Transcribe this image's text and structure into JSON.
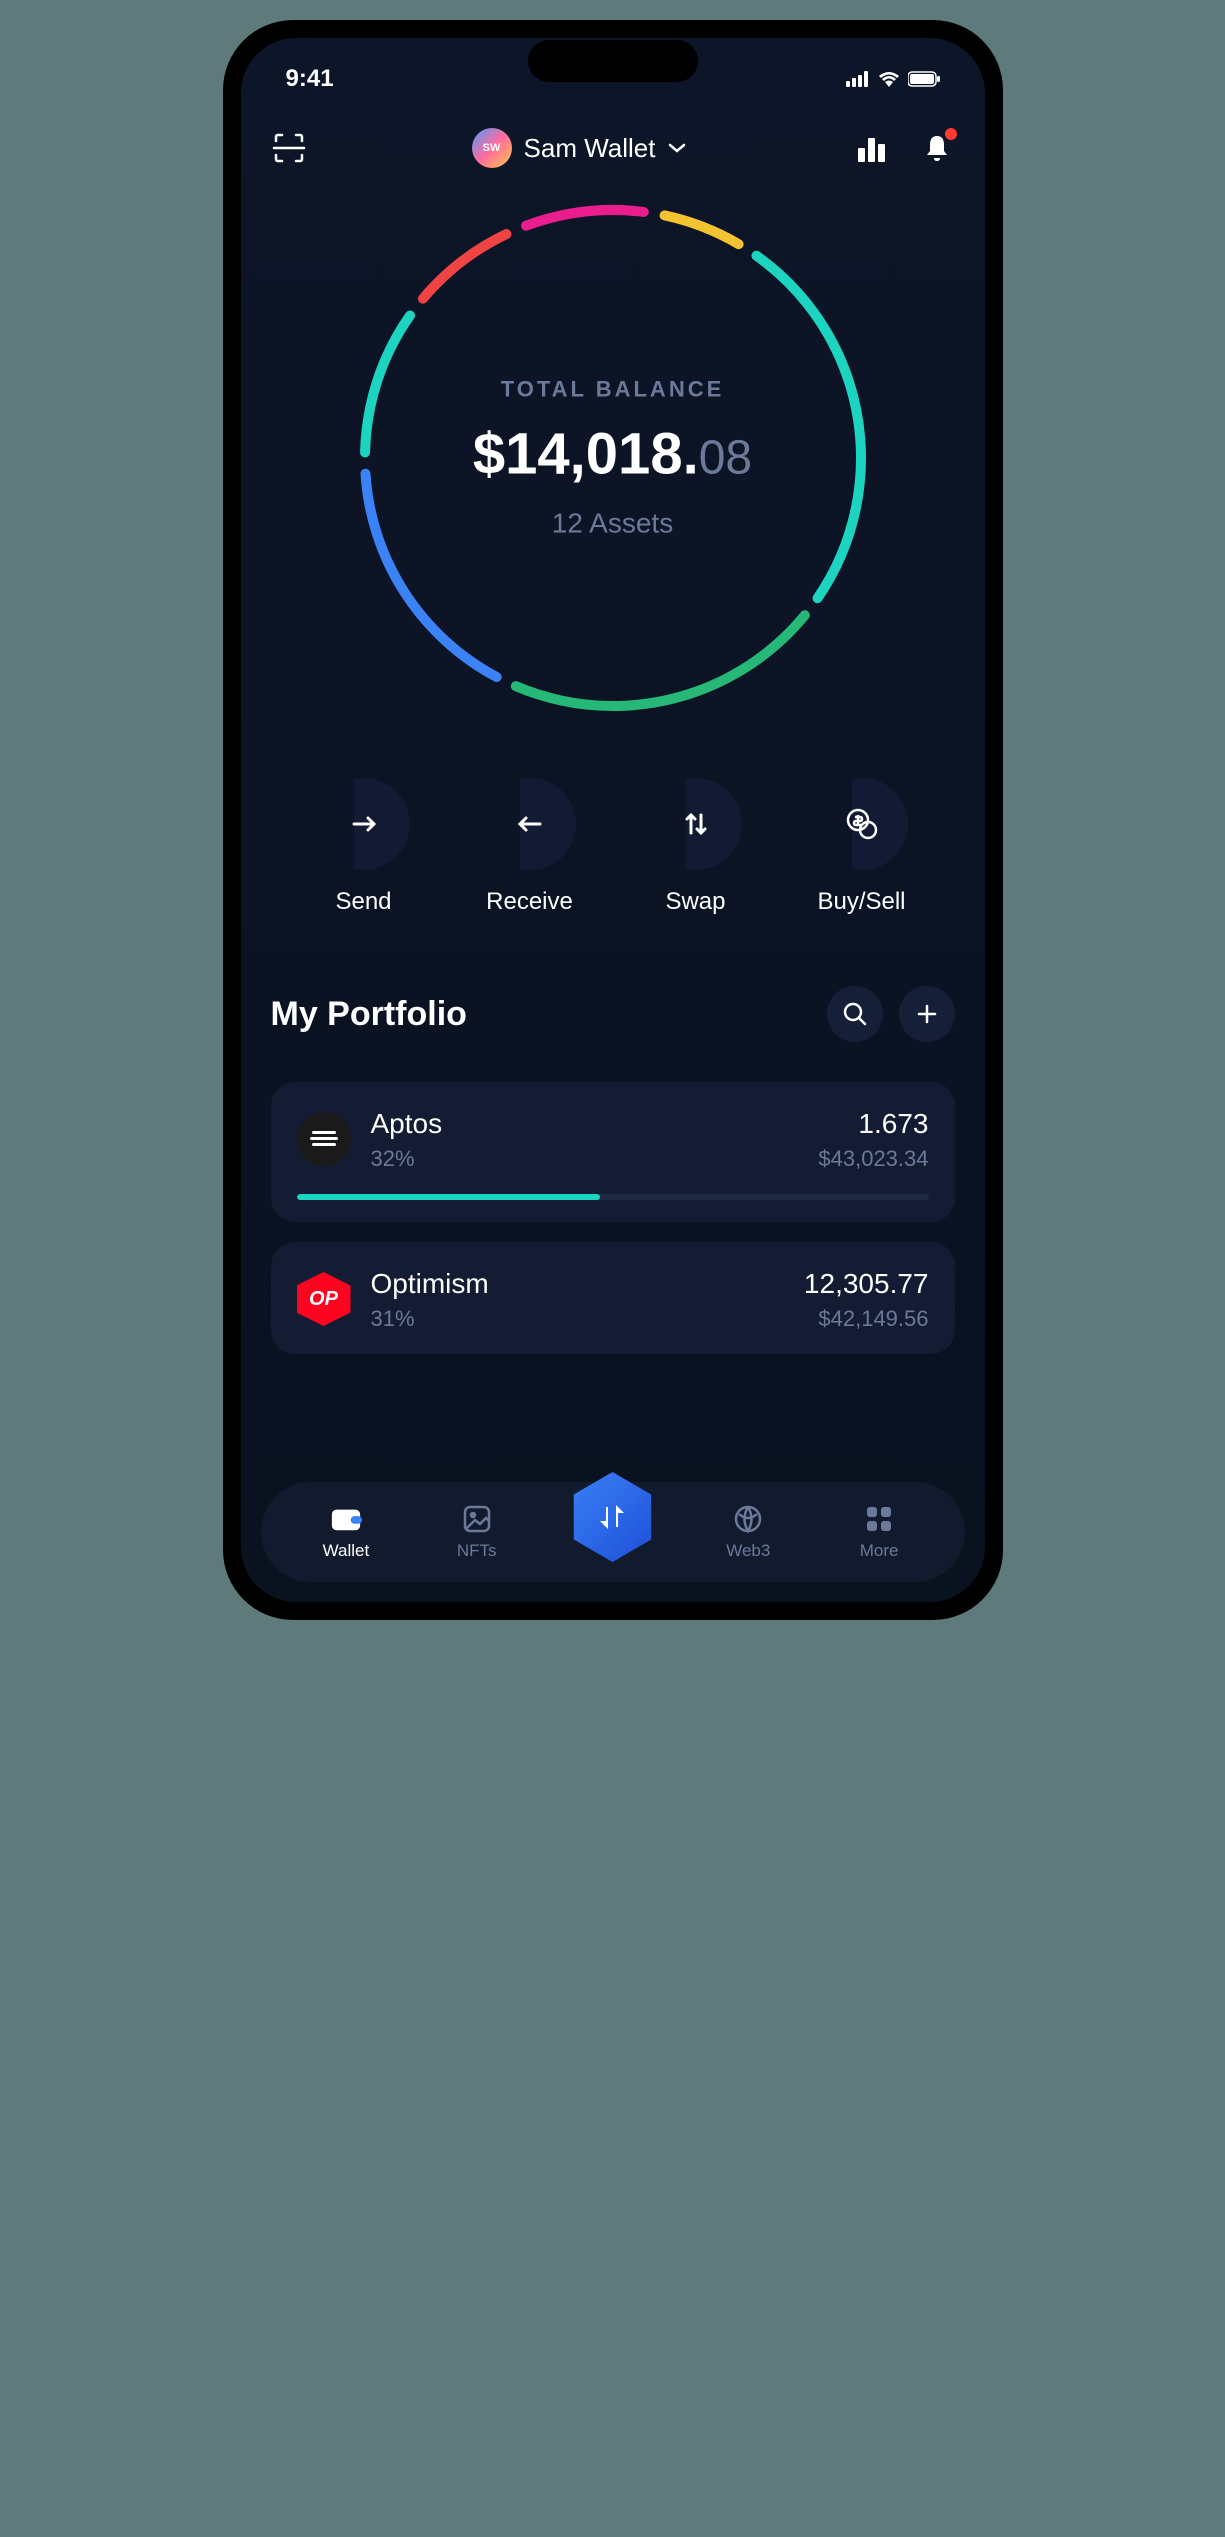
{
  "status": {
    "time": "9:41"
  },
  "header": {
    "wallet_initials": "SW",
    "wallet_name": "Sam Wallet"
  },
  "balance": {
    "label": "TOTAL BALANCE",
    "major": "$14,018.",
    "cents": "08",
    "asset_count": "12 Assets"
  },
  "ring_segments": [
    {
      "color": "#f4c430",
      "length": 30
    },
    {
      "color": "#1cd4c0",
      "length": 145
    },
    {
      "color": "#25b877",
      "length": 120
    },
    {
      "color": "#3b82f6",
      "length": 95
    },
    {
      "color": "#1cd4c0",
      "length": 55
    },
    {
      "color": "#ef4444",
      "length": 40
    },
    {
      "color": "#e91e8c",
      "length": 45
    }
  ],
  "actions": {
    "send": "Send",
    "receive": "Receive",
    "swap": "Swap",
    "buysell": "Buy/Sell"
  },
  "portfolio": {
    "title": "My Portfolio",
    "assets": [
      {
        "name": "Aptos",
        "pct": "32%",
        "qty": "1.673",
        "usd": "$43,023.34",
        "progress": 48,
        "icon": "aptos"
      },
      {
        "name": "Optimism",
        "pct": "31%",
        "qty": "12,305.77",
        "usd": "$42,149.56",
        "progress": 0,
        "icon": "optimism"
      }
    ]
  },
  "nav": {
    "wallet": "Wallet",
    "nfts": "NFTs",
    "web3": "Web3",
    "more": "More"
  },
  "chart_data": {
    "type": "pie",
    "title": "TOTAL BALANCE",
    "total_label": "$14,018.08",
    "subtitle": "12 Assets",
    "series": [
      {
        "name": "segment-yellow",
        "color": "#f4c430",
        "value": 30
      },
      {
        "name": "segment-teal",
        "color": "#1cd4c0",
        "value": 145
      },
      {
        "name": "segment-green",
        "color": "#25b877",
        "value": 120
      },
      {
        "name": "segment-blue",
        "color": "#3b82f6",
        "value": 95
      },
      {
        "name": "segment-teal2",
        "color": "#1cd4c0",
        "value": 55
      },
      {
        "name": "segment-red",
        "color": "#ef4444",
        "value": 40
      },
      {
        "name": "segment-magenta",
        "color": "#e91e8c",
        "value": 45
      }
    ]
  }
}
